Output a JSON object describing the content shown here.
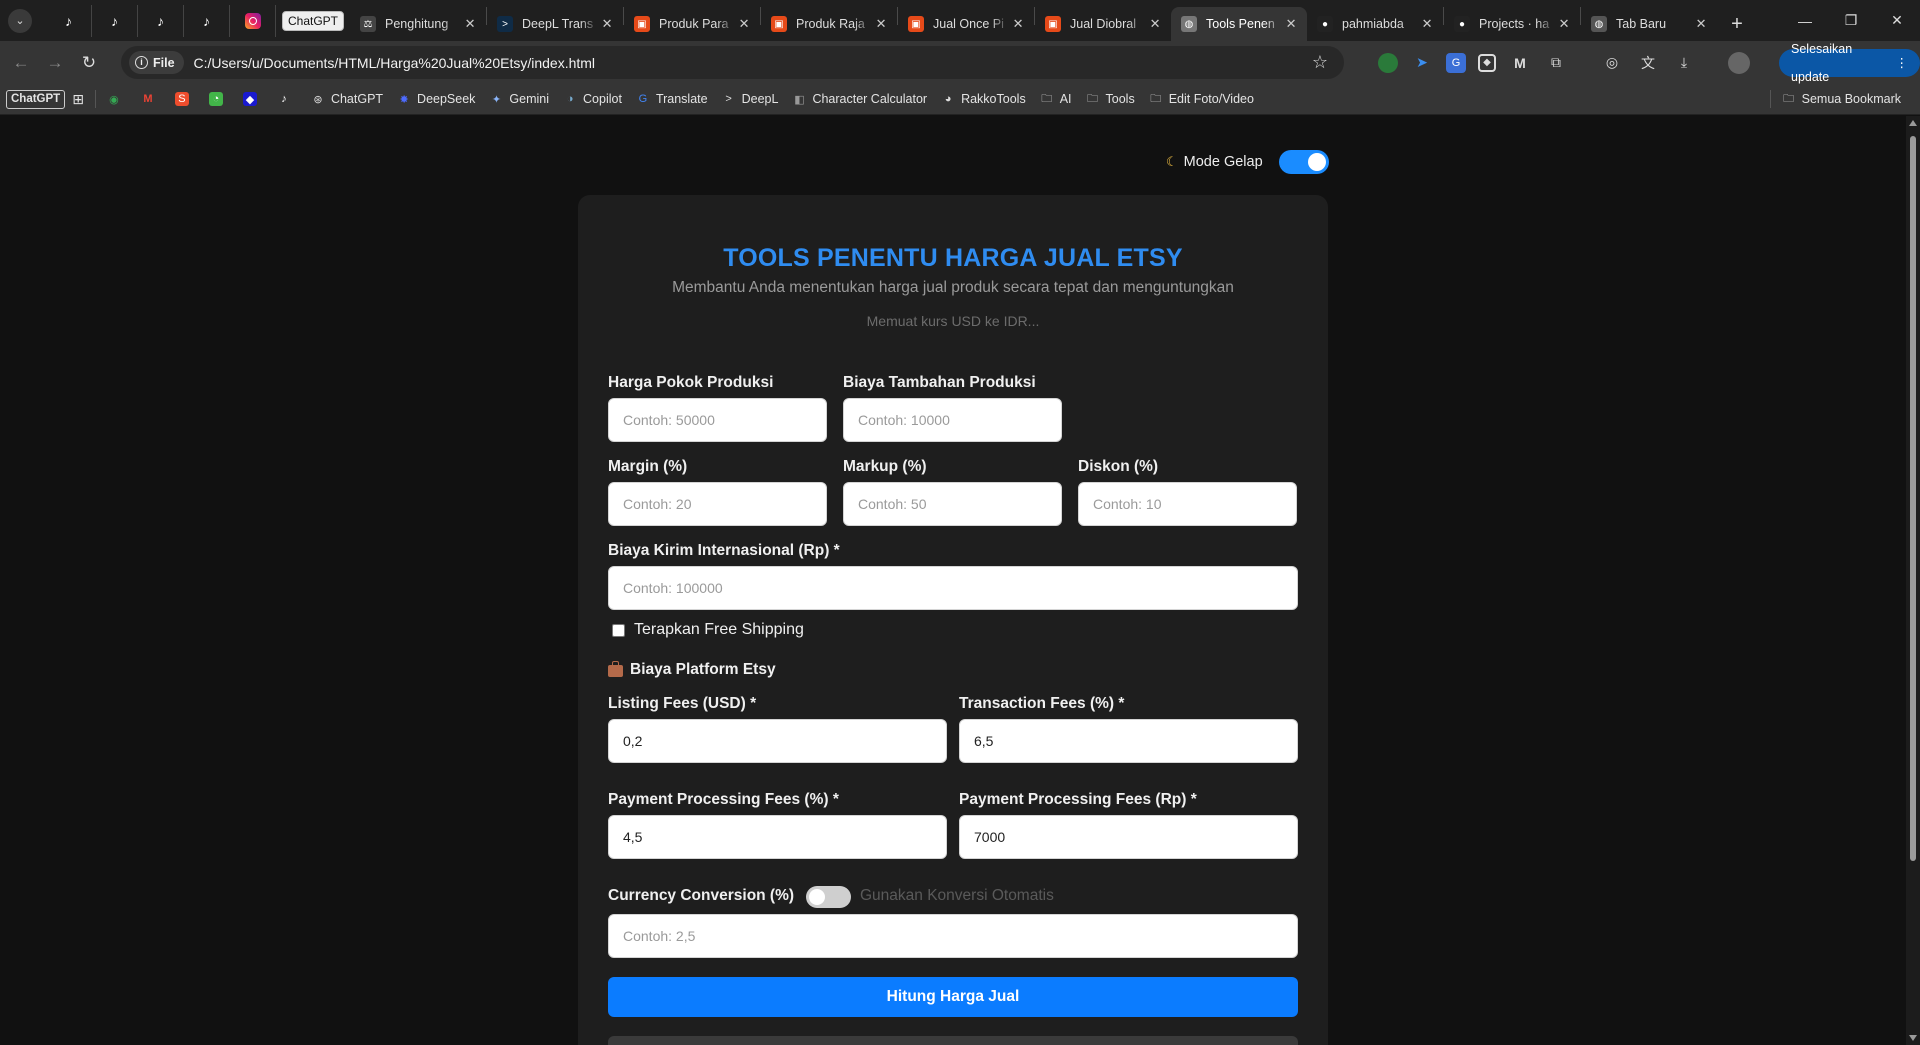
{
  "tabs": [
    {
      "title": "Penghitung",
      "fav_color": "#444",
      "fav_glyph": "⚖"
    },
    {
      "title": "DeepL Trans",
      "fav_color": "#0f2b46",
      "fav_glyph": ">"
    },
    {
      "title": "Produk Para",
      "fav_color": "#e64a19",
      "fav_glyph": "▣"
    },
    {
      "title": "Produk Raja",
      "fav_color": "#e64a19",
      "fav_glyph": "▣"
    },
    {
      "title": "Jual Once Pi",
      "fav_color": "#e64a19",
      "fav_glyph": "▣"
    },
    {
      "title": "Jual Diobral",
      "fav_color": "#e64a19",
      "fav_glyph": "▣"
    },
    {
      "title": "Tools Penen",
      "fav_color": "#777",
      "fav_glyph": "◍",
      "active": true
    },
    {
      "title": "pahmiabda",
      "fav_color": "#222",
      "fav_glyph": "●"
    },
    {
      "title": "Projects · ha",
      "fav_color": "#222",
      "fav_glyph": "●"
    },
    {
      "title": "Tab Baru",
      "fav_color": "#555",
      "fav_glyph": "◍"
    }
  ],
  "pinned_chip": "ChatGPT",
  "address": {
    "scheme_label": "File",
    "url": "C:/Users/u/Documents/HTML/Harga%20Jual%20Etsy/index.html"
  },
  "update_button": "Selesaikan update",
  "bookmarks": {
    "chip": "ChatGPT",
    "items": [
      "ChatGPT",
      "DeepSeek",
      "Gemini",
      "Copilot",
      "Translate",
      "DeepL",
      "Character Calculator",
      "RakkoTools"
    ],
    "folders": [
      "AI",
      "Tools",
      "Edit Foto/Video"
    ],
    "all_bookmarks": "Semua Bookmark"
  },
  "page": {
    "dark_mode_label": "Mode Gelap",
    "title": "TOOLS PENENTU HARGA JUAL ETSY",
    "subtitle": "Membantu Anda menentukan harga jual produk secara tepat dan menguntungkan",
    "rate_status": "Memuat kurs USD ke IDR...",
    "fields": {
      "harga_pokok": {
        "label": "Harga Pokok Produksi",
        "placeholder": "Contoh: 50000"
      },
      "biaya_tambahan": {
        "label": "Biaya Tambahan Produksi",
        "placeholder": "Contoh: 10000"
      },
      "margin": {
        "label": "Margin (%)",
        "placeholder": "Contoh: 20"
      },
      "markup": {
        "label": "Markup (%)",
        "placeholder": "Contoh: 50"
      },
      "diskon": {
        "label": "Diskon (%)",
        "placeholder": "Contoh: 10"
      },
      "kirim": {
        "label": "Biaya Kirim Internasional (Rp) *",
        "placeholder": "Contoh: 100000"
      },
      "listing": {
        "label": "Listing Fees (USD) *",
        "value": "0,2"
      },
      "transaction": {
        "label": "Transaction Fees (%) *",
        "value": "6,5"
      },
      "payment_pct": {
        "label": "Payment Processing Fees (%) *",
        "value": "4,5"
      },
      "payment_rp": {
        "label": "Payment Processing Fees (Rp) *",
        "value": "7000"
      },
      "currency": {
        "label": "Currency Conversion (%)",
        "placeholder": "Contoh: 2,5"
      }
    },
    "free_shipping_label": "Terapkan Free Shipping",
    "platform_section": "Biaya Platform Etsy",
    "auto_conversion_label": "Gunakan Konversi Otomatis",
    "calculate_button": "Hitung Harga Jual"
  }
}
